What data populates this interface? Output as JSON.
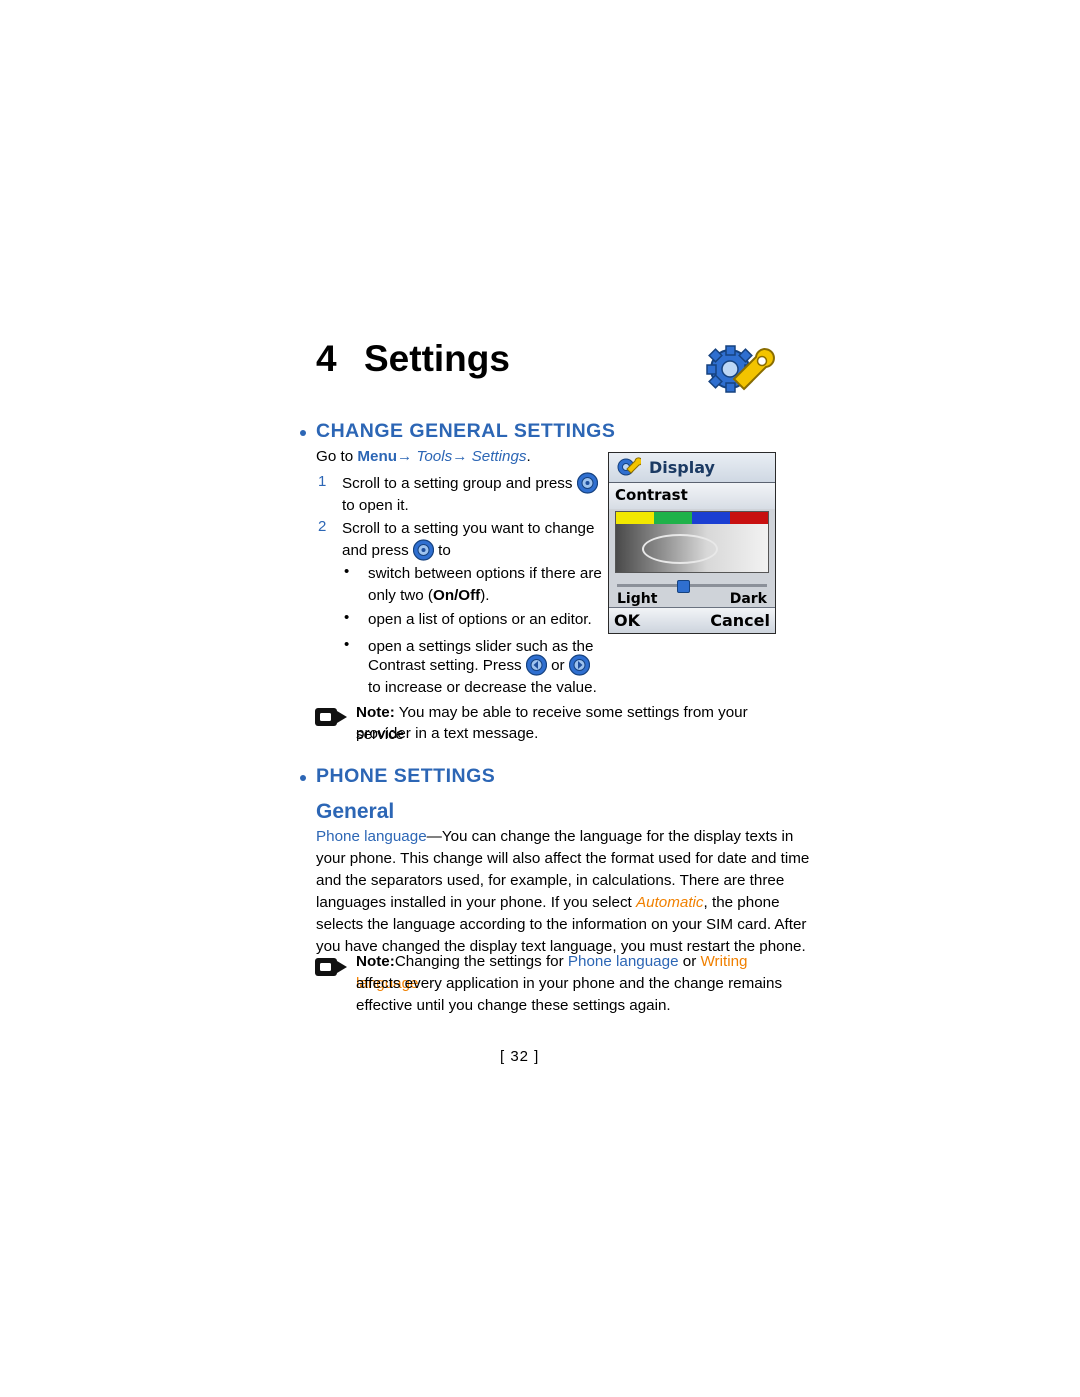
{
  "document": {
    "chapter_number": "4",
    "chapter_title": "Settings",
    "page_number": "[ 32 ]",
    "accent_color": "#2c66b5",
    "orange_color": "#f08000"
  },
  "sections": {
    "change_general_settings": {
      "heading": "CHANGE GENERAL SETTINGS",
      "path_prefix": "Go to ",
      "path_menu": "Menu",
      "path_arrow1": "→",
      "path_tools": "Tools",
      "path_arrow2": "→",
      "path_settings": "Settings",
      "path_period": ".",
      "steps": [
        {
          "num": "1",
          "line1_a": "Scroll to a setting group and press",
          "line1_b": "",
          "line2": "to open it."
        },
        {
          "num": "2",
          "line1_a": "Scroll to a setting you want to change",
          "line2_a": "and press",
          "line2_b": "to"
        }
      ],
      "bullets": [
        {
          "line1": "switch between options if there are",
          "line2_a": "only two (",
          "line2_bold": "On/Off",
          "line2_b": ")."
        },
        {
          "line1": "open a list of options or an editor."
        },
        {
          "line1": "open a settings slider such as the",
          "line2_a": "Contrast setting. Press",
          "line2_or": "or",
          "line3": "to increase or decrease the value."
        }
      ],
      "note": {
        "label": "Note:",
        "text_line1": "You may be able to receive some settings from your service",
        "text_line2": "provider in a text message."
      }
    },
    "phone_settings": {
      "heading": "PHONE SETTINGS",
      "subheading": "General",
      "paragraph": {
        "term": "Phone language",
        "dash": "—",
        "line1_rest": "You can change the language for the display texts in",
        "line2": "your phone. This change will also affect the format used for date and time",
        "line3": "and the separators used, for example, in calculations. There are three",
        "line4_a": "languages installed in your phone. If you select ",
        "line4_italic": "Automatic",
        "line4_b": ", the phone",
        "line5": "selects the language according to the information on your SIM card. After",
        "line6": "you have changed the display text language, you must restart the phone."
      },
      "note": {
        "label": "Note:",
        "line1_a": "Changing the settings for ",
        "line1_link1": "Phone language",
        "line1_mid": " or ",
        "line1_link2": "Writing language",
        "line2": "affects every application in your phone and the change remains",
        "line3": "effective until you change these settings again."
      }
    }
  },
  "phone_screenshot": {
    "title": "Display",
    "subtitle": "Contrast",
    "slider_left_label": "Light",
    "slider_right_label": "Dark",
    "softkey_left": "OK",
    "softkey_right": "Cancel",
    "colorbar": [
      "#f2e800",
      "#1fb24a",
      "#1b3fd2",
      "#c81010"
    ]
  }
}
